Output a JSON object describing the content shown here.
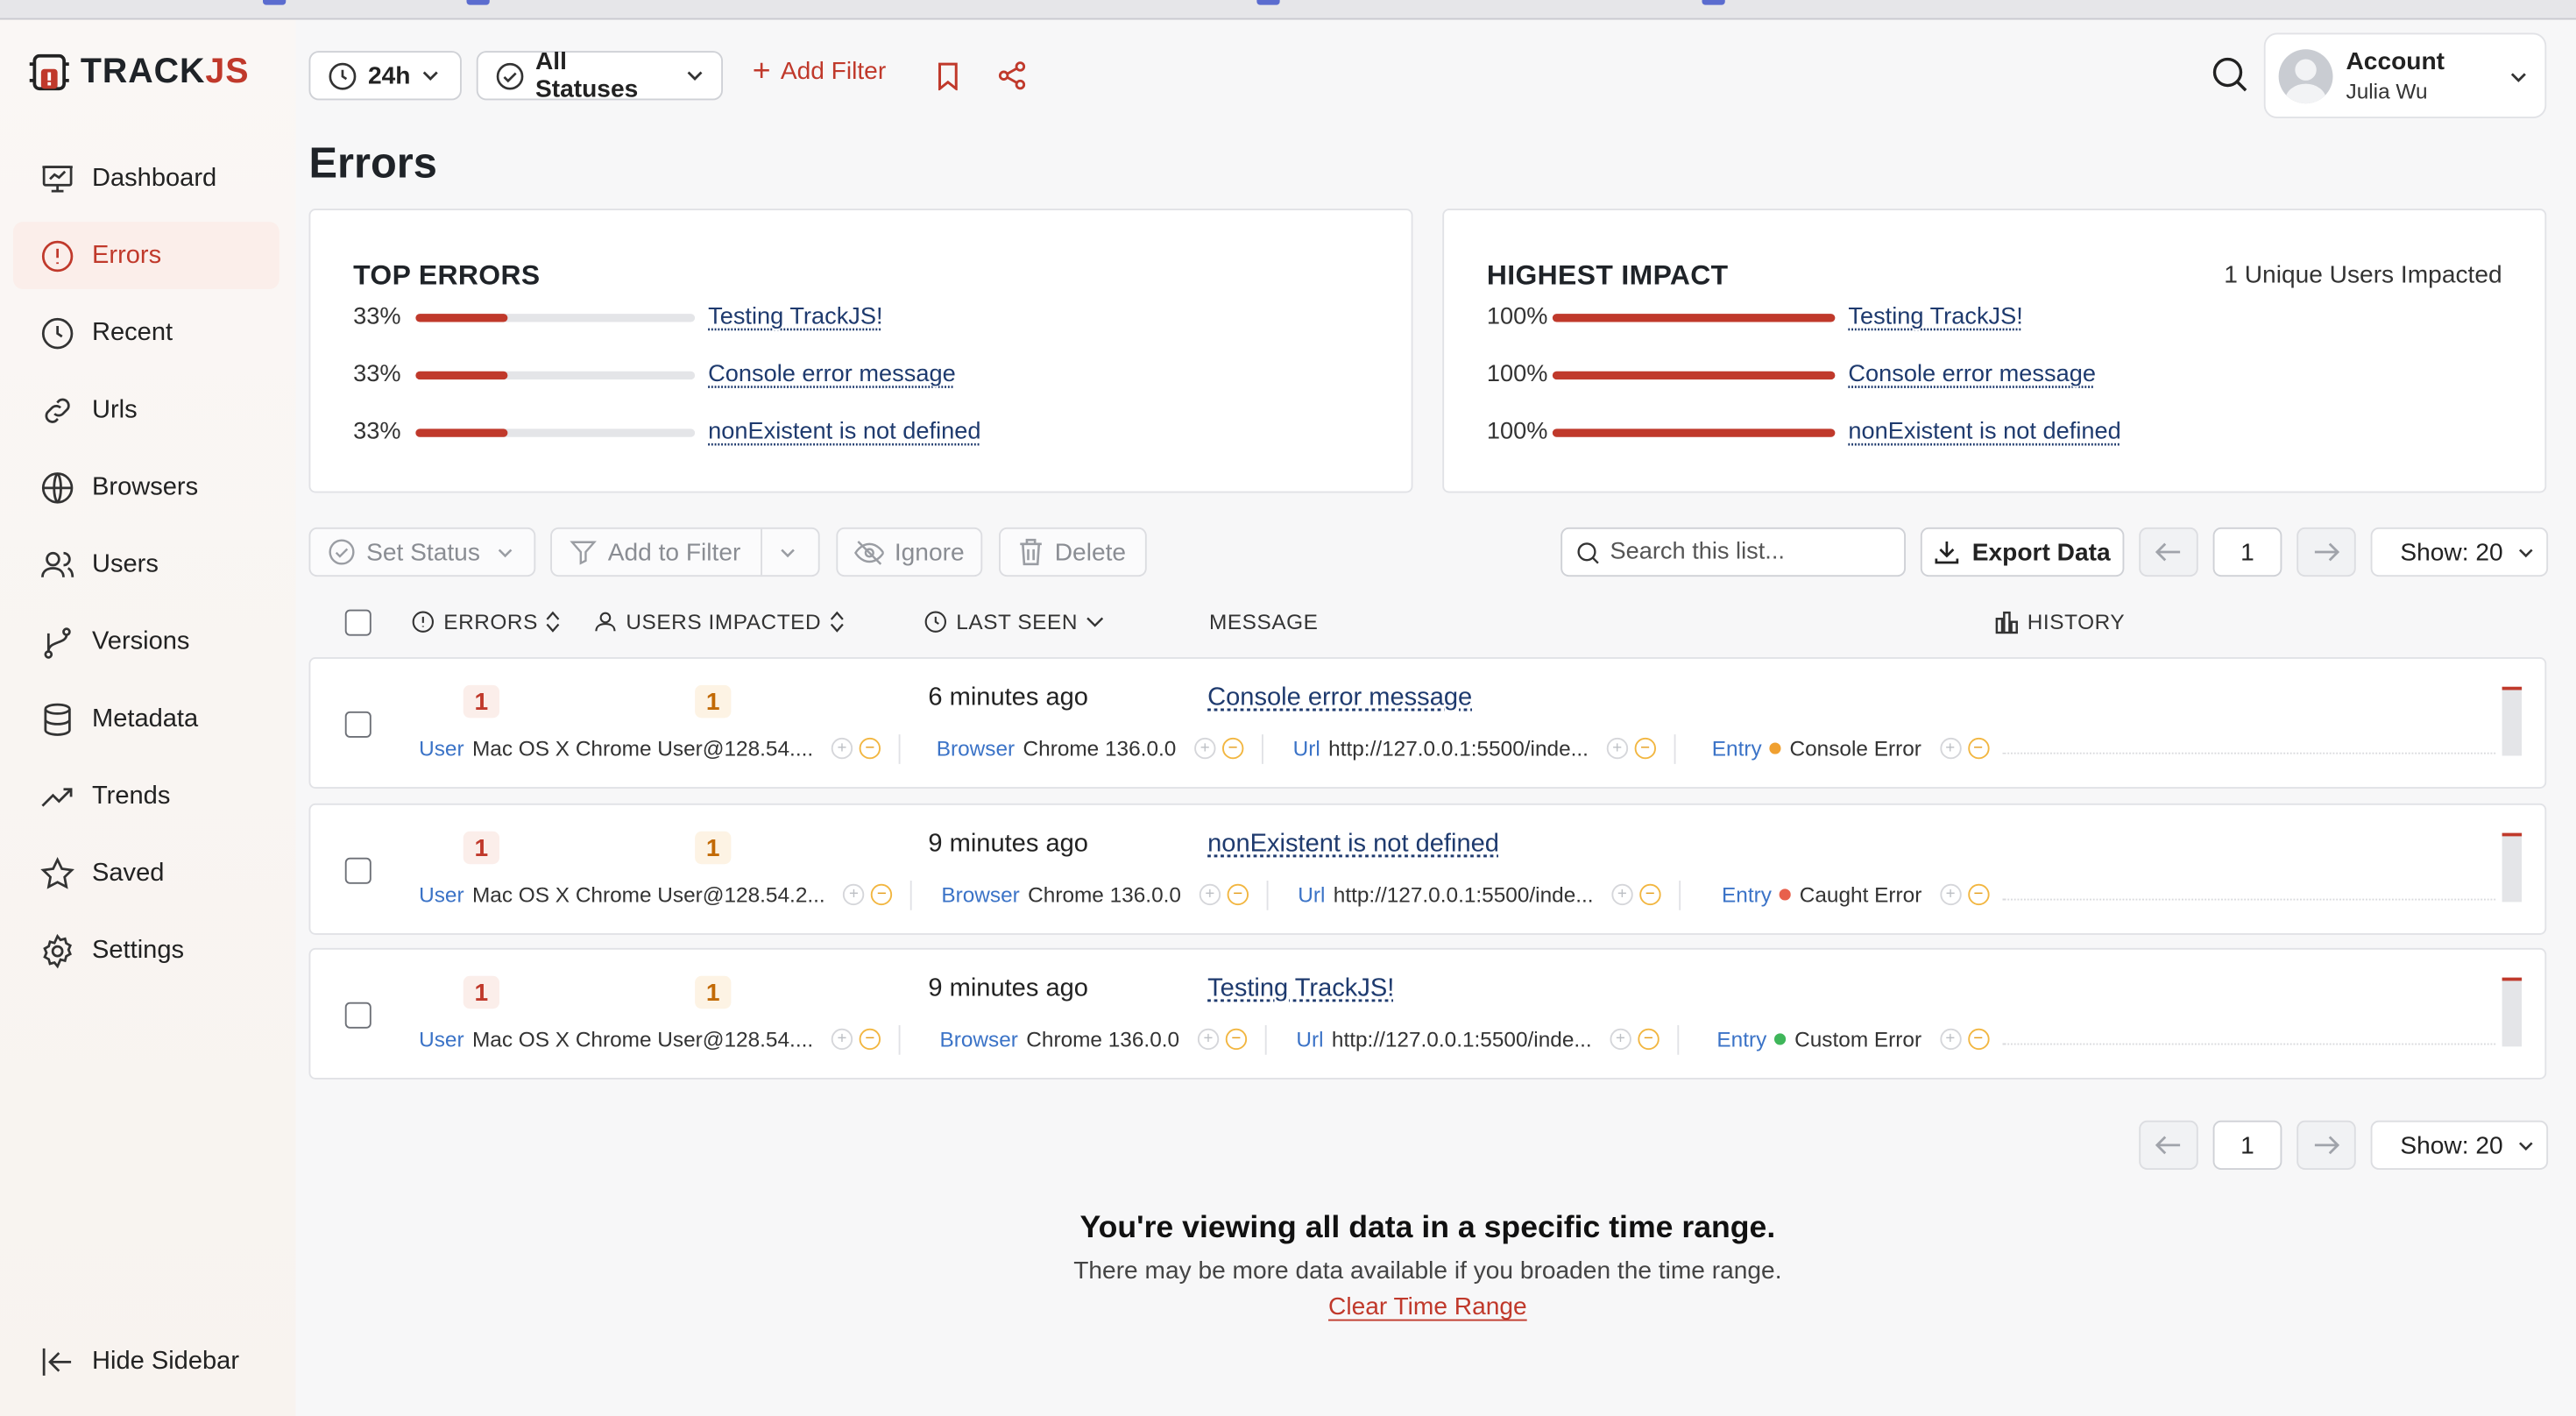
{
  "app": {
    "logo_main": "TRACK",
    "logo_accent": "JS"
  },
  "sidebar": {
    "items": [
      {
        "label": "Dashboard",
        "icon": "dashboard-icon"
      },
      {
        "label": "Errors",
        "icon": "error-circle-icon",
        "active": true
      },
      {
        "label": "Recent",
        "icon": "clock-icon"
      },
      {
        "label": "Urls",
        "icon": "link-icon"
      },
      {
        "label": "Browsers",
        "icon": "globe-icon"
      },
      {
        "label": "Users",
        "icon": "users-icon"
      },
      {
        "label": "Versions",
        "icon": "branch-icon"
      },
      {
        "label": "Metadata",
        "icon": "database-icon"
      },
      {
        "label": "Trends",
        "icon": "trend-icon"
      },
      {
        "label": "Saved",
        "icon": "star-icon"
      },
      {
        "label": "Settings",
        "icon": "gear-icon"
      }
    ],
    "hide_label": "Hide Sidebar"
  },
  "topbar": {
    "time_range": "24h",
    "status_filter": "All Statuses",
    "add_filter": "Add Filter"
  },
  "account": {
    "label": "Account",
    "user": "Julia Wu"
  },
  "page": {
    "title": "Errors"
  },
  "top_errors": {
    "title": "TOP ERRORS",
    "rows": [
      {
        "pct_text": "33%",
        "fraction": 0.33,
        "label": "Testing TrackJS!"
      },
      {
        "pct_text": "33%",
        "fraction": 0.33,
        "label": "Console error message"
      },
      {
        "pct_text": "33%",
        "fraction": 0.33,
        "label": "nonExistent is not defined"
      }
    ]
  },
  "highest_impact": {
    "title": "HIGHEST IMPACT",
    "subtitle": "1 Unique Users Impacted",
    "rows": [
      {
        "pct_text": "100%",
        "fraction": 1.0,
        "label": "Testing TrackJS!"
      },
      {
        "pct_text": "100%",
        "fraction": 1.0,
        "label": "Console error message"
      },
      {
        "pct_text": "100%",
        "fraction": 1.0,
        "label": "nonExistent is not defined"
      }
    ]
  },
  "toolbar": {
    "set_status": "Set Status",
    "add_to_filter": "Add to Filter",
    "ignore": "Ignore",
    "delete": "Delete",
    "search_placeholder": "Search this list...",
    "export": "Export Data",
    "page": "1",
    "show": "Show: 20"
  },
  "table": {
    "headers": {
      "errors": "ERRORS",
      "users": "USERS IMPACTED",
      "last_seen": "LAST SEEN",
      "message": "MESSAGE",
      "history": "HISTORY"
    },
    "rows": [
      {
        "errors": "1",
        "users": "1",
        "last_seen": "6 minutes ago",
        "message": "Console error message",
        "user_key": "User",
        "user_val": "Mac OS X Chrome User@128.54....",
        "browser_key": "Browser",
        "browser_val": "Chrome 136.0.0",
        "url_key": "Url",
        "url_val": "http://127.0.0.1:5500/inde...",
        "entry_key": "Entry",
        "entry_val": "Console Error",
        "entry_color": "#f0a030"
      },
      {
        "errors": "1",
        "users": "1",
        "last_seen": "9 minutes ago",
        "message": "nonExistent is not defined",
        "user_key": "User",
        "user_val": "Mac OS X Chrome User@128.54.2...",
        "browser_key": "Browser",
        "browser_val": "Chrome 136.0.0",
        "url_key": "Url",
        "url_val": "http://127.0.0.1:5500/inde...",
        "entry_key": "Entry",
        "entry_val": "Caught Error",
        "entry_color": "#e8604c"
      },
      {
        "errors": "1",
        "users": "1",
        "last_seen": "9 minutes ago",
        "message": "Testing TrackJS!",
        "user_key": "User",
        "user_val": "Mac OS X Chrome User@128.54....",
        "browser_key": "Browser",
        "browser_val": "Chrome 136.0.0",
        "url_key": "Url",
        "url_val": "http://127.0.0.1:5500/inde...",
        "entry_key": "Entry",
        "entry_val": "Custom Error",
        "entry_color": "#3fb65a"
      }
    ]
  },
  "bottom_pager": {
    "page": "1",
    "show": "Show: 20"
  },
  "footer": {
    "title": "You're viewing all data in a specific time range.",
    "subtitle": "There may be more data available if you broaden the time range.",
    "link": "Clear Time Range"
  },
  "colors": {
    "accent": "#c0392b",
    "link": "#1e3a6e",
    "meta_key": "#3b73c7"
  }
}
